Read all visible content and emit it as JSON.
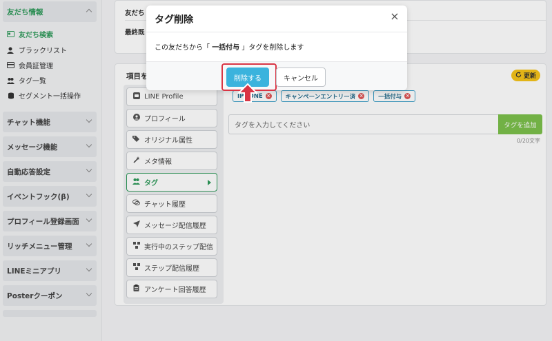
{
  "sidebar": {
    "active_group": "友だち情報",
    "sub_items": [
      {
        "label": "友だち検索",
        "icon": "id-card-icon",
        "active": true
      },
      {
        "label": "ブラックリスト",
        "icon": "user-block-icon",
        "active": false
      },
      {
        "label": "会員証管理",
        "icon": "card-icon",
        "active": false
      },
      {
        "label": "タグ一覧",
        "icon": "users-icon",
        "active": false
      },
      {
        "label": "セグメント一括操作",
        "icon": "database-icon",
        "active": false
      }
    ],
    "groups": [
      "チャット機能",
      "メッセージ機能",
      "自動応答設定",
      "イベントフック(β)",
      "プロフィール登録画面",
      "リッチメニュー管理",
      "LINEミニアプリ",
      "Posterクーポン"
    ]
  },
  "top_card": {
    "row1": "友だち",
    "row2": "最終既"
  },
  "main": {
    "items_label": "項目を",
    "refresh_label": "更新",
    "nav": [
      {
        "label": "LINE Profile",
        "icon": "line-icon"
      },
      {
        "label": "プロフィール",
        "icon": "user-circle-icon"
      },
      {
        "label": "オリジナル属性",
        "icon": "tags-icon"
      },
      {
        "label": "メタ情報",
        "icon": "wand-icon"
      },
      {
        "label": "タグ",
        "icon": "users-icon",
        "active": true
      },
      {
        "label": "チャット履歴",
        "icon": "chat-icon"
      },
      {
        "label": "メッセージ配信履歴",
        "icon": "send-icon"
      },
      {
        "label": "実行中のステップ配信",
        "icon": "step-icon"
      },
      {
        "label": "ステップ配信履歴",
        "icon": "step-icon"
      },
      {
        "label": "アンケート回答履歴",
        "icon": "clipboard-icon"
      }
    ],
    "tags": [
      "IPHONE",
      "キャンペーンエントリー済",
      "一括付与"
    ],
    "tag_input_placeholder": "タグを入力してください",
    "add_tag_label": "タグを追加",
    "counter": "0/20文字"
  },
  "modal": {
    "title": "タグ削除",
    "body_prefix": "この友だちから「 ",
    "body_tag": "一括付与",
    "body_suffix": " 」タグを削除します",
    "confirm_label": "削除する",
    "cancel_label": "キャンセル"
  },
  "colors": {
    "accent_green": "#2e9a5a",
    "primary_blue": "#3bb3dd",
    "highlight_red": "#d93545",
    "add_green": "#7cc04b",
    "refresh_yellow": "#f6c419"
  }
}
